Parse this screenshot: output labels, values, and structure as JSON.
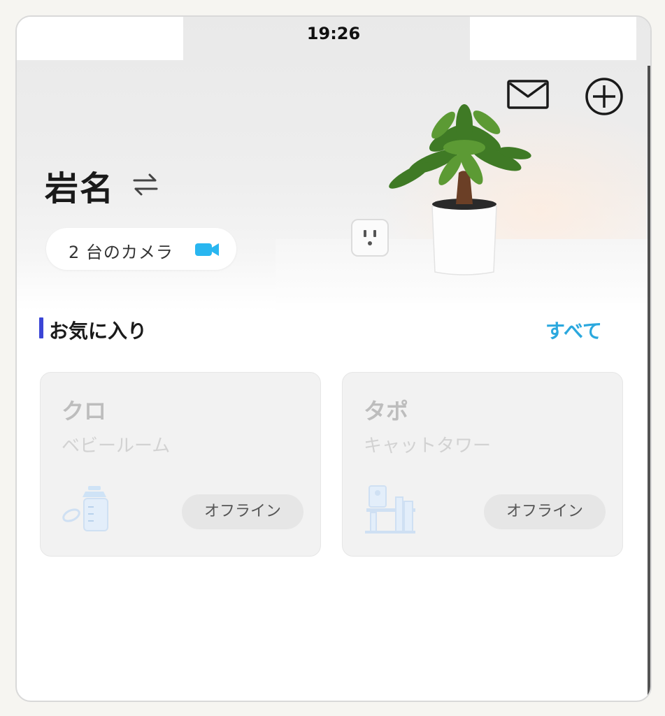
{
  "status_bar": {
    "time": "19:26"
  },
  "header": {
    "home_name": "岩名",
    "swap_icon": "swap-arrows-icon",
    "mail_icon": "mail-icon",
    "add_icon": "add-circle-icon",
    "camera_count_label": "2 台のカメラ",
    "camera_icon": "video-camera-icon"
  },
  "favorites": {
    "title": "お気に入り",
    "see_all": "すべて",
    "cameras": [
      {
        "name": "クロ",
        "room": "ベビールーム",
        "status": "オフライン",
        "icon": "baby-bottle-icon"
      },
      {
        "name": "タポ",
        "room": "キャットタワー",
        "status": "オフライン",
        "icon": "cat-tower-icon"
      }
    ]
  },
  "colors": {
    "accent": "#2ba8de",
    "section_marker": "#3b45d6",
    "camera_icon": "#29b6f0"
  }
}
